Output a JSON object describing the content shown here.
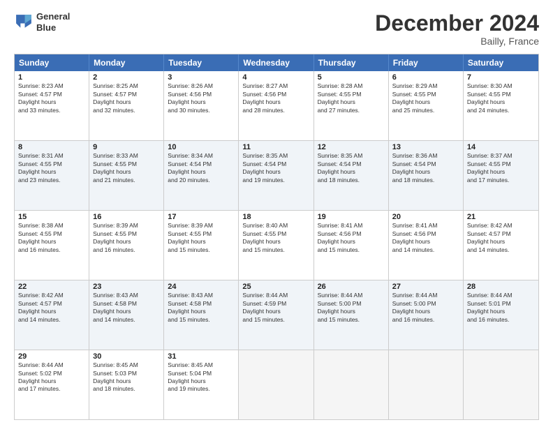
{
  "header": {
    "logo_line1": "General",
    "logo_line2": "Blue",
    "title": "December 2024",
    "subtitle": "Bailly, France"
  },
  "days": [
    "Sunday",
    "Monday",
    "Tuesday",
    "Wednesday",
    "Thursday",
    "Friday",
    "Saturday"
  ],
  "rows": [
    [
      {
        "day": "1",
        "rise": "8:23 AM",
        "set": "4:57 PM",
        "daylight": "8 hours and 33 minutes."
      },
      {
        "day": "2",
        "rise": "8:25 AM",
        "set": "4:57 PM",
        "daylight": "8 hours and 32 minutes."
      },
      {
        "day": "3",
        "rise": "8:26 AM",
        "set": "4:56 PM",
        "daylight": "8 hours and 30 minutes."
      },
      {
        "day": "4",
        "rise": "8:27 AM",
        "set": "4:56 PM",
        "daylight": "8 hours and 28 minutes."
      },
      {
        "day": "5",
        "rise": "8:28 AM",
        "set": "4:55 PM",
        "daylight": "8 hours and 27 minutes."
      },
      {
        "day": "6",
        "rise": "8:29 AM",
        "set": "4:55 PM",
        "daylight": "8 hours and 25 minutes."
      },
      {
        "day": "7",
        "rise": "8:30 AM",
        "set": "4:55 PM",
        "daylight": "8 hours and 24 minutes."
      }
    ],
    [
      {
        "day": "8",
        "rise": "8:31 AM",
        "set": "4:55 PM",
        "daylight": "8 hours and 23 minutes."
      },
      {
        "day": "9",
        "rise": "8:33 AM",
        "set": "4:55 PM",
        "daylight": "8 hours and 21 minutes."
      },
      {
        "day": "10",
        "rise": "8:34 AM",
        "set": "4:54 PM",
        "daylight": "8 hours and 20 minutes."
      },
      {
        "day": "11",
        "rise": "8:35 AM",
        "set": "4:54 PM",
        "daylight": "8 hours and 19 minutes."
      },
      {
        "day": "12",
        "rise": "8:35 AM",
        "set": "4:54 PM",
        "daylight": "8 hours and 18 minutes."
      },
      {
        "day": "13",
        "rise": "8:36 AM",
        "set": "4:54 PM",
        "daylight": "8 hours and 18 minutes."
      },
      {
        "day": "14",
        "rise": "8:37 AM",
        "set": "4:55 PM",
        "daylight": "8 hours and 17 minutes."
      }
    ],
    [
      {
        "day": "15",
        "rise": "8:38 AM",
        "set": "4:55 PM",
        "daylight": "8 hours and 16 minutes."
      },
      {
        "day": "16",
        "rise": "8:39 AM",
        "set": "4:55 PM",
        "daylight": "8 hours and 16 minutes."
      },
      {
        "day": "17",
        "rise": "8:39 AM",
        "set": "4:55 PM",
        "daylight": "8 hours and 15 minutes."
      },
      {
        "day": "18",
        "rise": "8:40 AM",
        "set": "4:55 PM",
        "daylight": "8 hours and 15 minutes."
      },
      {
        "day": "19",
        "rise": "8:41 AM",
        "set": "4:56 PM",
        "daylight": "8 hours and 15 minutes."
      },
      {
        "day": "20",
        "rise": "8:41 AM",
        "set": "4:56 PM",
        "daylight": "8 hours and 14 minutes."
      },
      {
        "day": "21",
        "rise": "8:42 AM",
        "set": "4:57 PM",
        "daylight": "8 hours and 14 minutes."
      }
    ],
    [
      {
        "day": "22",
        "rise": "8:42 AM",
        "set": "4:57 PM",
        "daylight": "8 hours and 14 minutes."
      },
      {
        "day": "23",
        "rise": "8:43 AM",
        "set": "4:58 PM",
        "daylight": "8 hours and 14 minutes."
      },
      {
        "day": "24",
        "rise": "8:43 AM",
        "set": "4:58 PM",
        "daylight": "8 hours and 15 minutes."
      },
      {
        "day": "25",
        "rise": "8:44 AM",
        "set": "4:59 PM",
        "daylight": "8 hours and 15 minutes."
      },
      {
        "day": "26",
        "rise": "8:44 AM",
        "set": "5:00 PM",
        "daylight": "8 hours and 15 minutes."
      },
      {
        "day": "27",
        "rise": "8:44 AM",
        "set": "5:00 PM",
        "daylight": "8 hours and 16 minutes."
      },
      {
        "day": "28",
        "rise": "8:44 AM",
        "set": "5:01 PM",
        "daylight": "8 hours and 16 minutes."
      }
    ],
    [
      {
        "day": "29",
        "rise": "8:44 AM",
        "set": "5:02 PM",
        "daylight": "8 hours and 17 minutes."
      },
      {
        "day": "30",
        "rise": "8:45 AM",
        "set": "5:03 PM",
        "daylight": "8 hours and 18 minutes."
      },
      {
        "day": "31",
        "rise": "8:45 AM",
        "set": "5:04 PM",
        "daylight": "8 hours and 19 minutes."
      },
      null,
      null,
      null,
      null
    ]
  ]
}
